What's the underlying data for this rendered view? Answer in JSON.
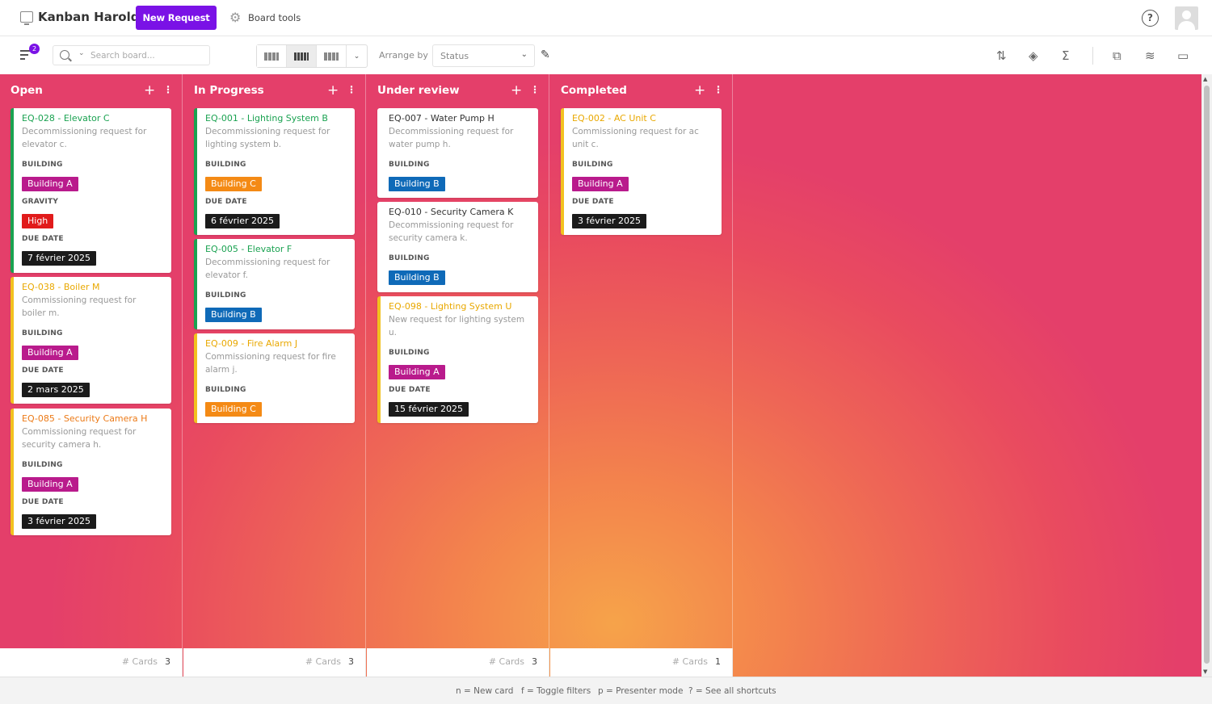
{
  "header": {
    "board_title": "Kanban Harold",
    "new_request_label": "New Request",
    "board_tools_label": "Board tools",
    "help_label": "?"
  },
  "toolbar": {
    "filter_count": "2",
    "search_placeholder": "Search board...",
    "arrange_label": "Arrange by",
    "arrange_value": "Status"
  },
  "columns": [
    {
      "title": "Open",
      "cards_label": "# Cards",
      "cards_count": "3",
      "cards": [
        {
          "title": "EQ-028 - Elevator C",
          "desc": "Decommissioning request for elevator c.",
          "building_label": "BUILDING",
          "building": "Building A",
          "gravity_label": "GRAVITY",
          "gravity": "High",
          "due_label": "DUE DATE",
          "due": "7 février 2025"
        },
        {
          "title": "EQ-038 - Boiler M",
          "desc": "Commissioning request for boiler m.",
          "building_label": "BUILDING",
          "building": "Building A",
          "due_label": "DUE DATE",
          "due": "2 mars 2025"
        },
        {
          "title": "EQ-085 - Security Camera H",
          "desc": "Commissioning request for security camera h.",
          "building_label": "BUILDING",
          "building": "Building A",
          "due_label": "DUE DATE",
          "due": "3 février 2025"
        }
      ]
    },
    {
      "title": "In Progress",
      "cards_label": "# Cards",
      "cards_count": "3",
      "cards": [
        {
          "title": "EQ-001 - Lighting System B",
          "desc": "Decommissioning request for lighting system b.",
          "building_label": "BUILDING",
          "building": "Building C",
          "due_label": "DUE DATE",
          "due": "6 février 2025"
        },
        {
          "title": "EQ-005 - Elevator F",
          "desc": "Decommissioning request for elevator f.",
          "building_label": "BUILDING",
          "building": "Building B"
        },
        {
          "title": "EQ-009 - Fire Alarm J",
          "desc": "Commissioning request for fire alarm j.",
          "building_label": "BUILDING",
          "building": "Building C"
        }
      ]
    },
    {
      "title": "Under review",
      "cards_label": "# Cards",
      "cards_count": "3",
      "cards": [
        {
          "title": "EQ-007 - Water Pump H",
          "desc": "Decommissioning request for water pump h.",
          "building_label": "BUILDING",
          "building": "Building B"
        },
        {
          "title": "EQ-010 - Security Camera K",
          "desc": "Decommissioning request for security camera k.",
          "building_label": "BUILDING",
          "building": "Building B"
        },
        {
          "title": "EQ-098 - Lighting System U",
          "desc": "New request for lighting system u.",
          "building_label": "BUILDING",
          "building": "Building A",
          "due_label": "DUE DATE",
          "due": "15 février 2025"
        }
      ]
    },
    {
      "title": "Completed",
      "cards_label": "# Cards",
      "cards_count": "1",
      "cards": [
        {
          "title": "EQ-002 - AC Unit C",
          "desc": "Commissioning request for ac unit c.",
          "building_label": "BUILDING",
          "building": "Building A",
          "due_label": "DUE DATE",
          "due": "3 février 2025"
        }
      ]
    }
  ],
  "shortcuts": [
    "n = New card",
    "f = Toggle filters",
    "p = Presenter mode",
    "? = See all shortcuts"
  ],
  "colors": {
    "accent": "#7a12e6",
    "green": "#1aa251",
    "yellow": "#f2c11f",
    "orange_tag": "#f48a15",
    "purple_tag": "#b91b8c",
    "blue_tag": "#0f6ab8",
    "red_tag": "#e11b1b"
  }
}
